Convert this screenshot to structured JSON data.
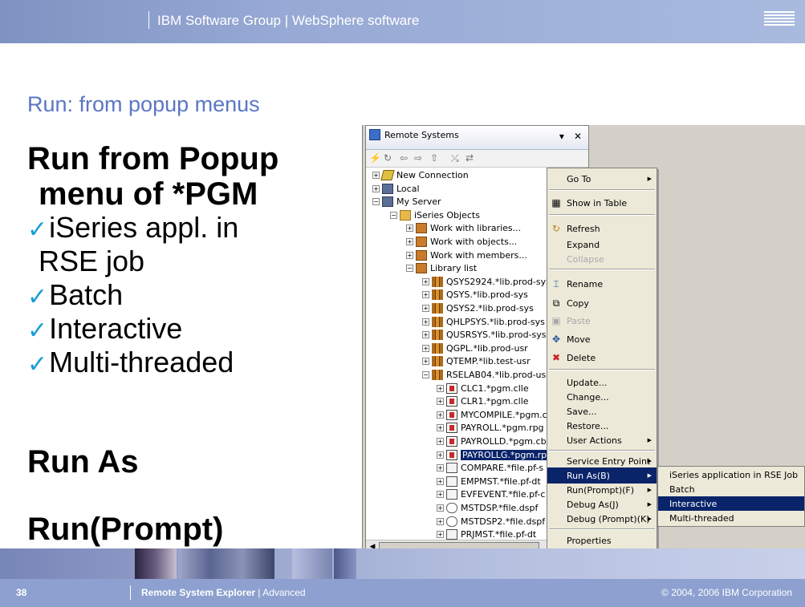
{
  "header": {
    "title": "IBM Software Group  |  WebSphere software",
    "logo_text": "IBM"
  },
  "slide": {
    "title": "Run: from popup menus",
    "heading1_line1": "Run from Popup",
    "heading1_line2": "menu of *PGM",
    "bullets": [
      {
        "check": "✓",
        "text": "iSeries appl. in"
      },
      {
        "check": "",
        "text": "RSE job"
      },
      {
        "check": "✓",
        "text": "Batch"
      },
      {
        "check": "✓",
        "text": "Interactive"
      },
      {
        "check": "✓",
        "text": "Multi-threaded"
      }
    ],
    "heading2": "Run As",
    "heading3": "Run(Prompt)",
    "check_color": "#1a9ed4"
  },
  "remote_systems": {
    "tab_title": "Remote Systems",
    "tree": [
      {
        "label": "New Connection",
        "icon": "conn"
      },
      {
        "label": "Local",
        "icon": "srv"
      },
      {
        "label": "My Server",
        "icon": "srv"
      },
      {
        "label": "iSeries Objects",
        "icon": "fold"
      },
      {
        "label": "Work with libraries...",
        "icon": "work"
      },
      {
        "label": "Work with objects...",
        "icon": "work"
      },
      {
        "label": "Work with members...",
        "icon": "work"
      },
      {
        "label": "Library list",
        "icon": "work"
      },
      {
        "label": "QSYS2924.*lib.prod-sys",
        "icon": "lib"
      },
      {
        "label": "QSYS.*lib.prod-sys",
        "icon": "lib"
      },
      {
        "label": "QSYS2.*lib.prod-sys",
        "icon": "lib"
      },
      {
        "label": "QHLPSYS.*lib.prod-sys",
        "icon": "lib"
      },
      {
        "label": "QUSRSYS.*lib.prod-sys",
        "icon": "lib"
      },
      {
        "label": "QGPL.*lib.prod-usr",
        "icon": "lib"
      },
      {
        "label": "QTEMP.*lib.test-usr",
        "icon": "lib"
      },
      {
        "label": "RSELAB04.*lib.prod-usr",
        "icon": "lib"
      },
      {
        "label": "CLC1.*pgm.clle",
        "icon": "pgm"
      },
      {
        "label": "CLR1.*pgm.clle",
        "icon": "pgm"
      },
      {
        "label": "MYCOMPILE.*pgm.c",
        "icon": "pgm"
      },
      {
        "label": "PAYROLL.*pgm.rpg",
        "icon": "pgm"
      },
      {
        "label": "PAYROLLD.*pgm.cb",
        "icon": "pgm"
      },
      {
        "label": "PAYROLLG.*pgm.rp",
        "icon": "pgm"
      },
      {
        "label": "COMPARE.*file.pf-s",
        "icon": "file"
      },
      {
        "label": "EMPMST.*file.pf-dt",
        "icon": "file"
      },
      {
        "label": "EVFEVENT.*file.pf-c",
        "icon": "file"
      },
      {
        "label": "MSTDSP.*file.dspf",
        "icon": "dspf"
      },
      {
        "label": "MSTDSP2.*file.dspf",
        "icon": "dspf"
      },
      {
        "label": "PRJMST.*file.pf-dt",
        "icon": "file"
      }
    ]
  },
  "context_menu": {
    "items": [
      "Go To",
      "Show in Table",
      "Refresh",
      "Expand",
      "Collapse",
      "Rename",
      "Copy",
      "Paste",
      "Move",
      "Delete",
      "Update...",
      "Change...",
      "Save...",
      "Restore...",
      "User Actions",
      "Service Entry Point",
      "Run As(B)",
      "Run(Prompt)(F)",
      "Debug As(J)",
      "Debug (Prompt)(K)",
      "Properties"
    ]
  },
  "run_as_submenu": {
    "items": [
      "iSeries application in RSE Job",
      "Batch",
      "Interactive",
      "Multi-threaded"
    ]
  },
  "footer": {
    "page": "38",
    "section": "Remote System Explorer",
    "subsection": "  |  Advanced",
    "copyright": "© 2004, 2006 IBM Corporation"
  },
  "colors": {
    "title_blue": "#5b76c4",
    "header_band": "#8da0cf",
    "menu_highlight": "#0a246a"
  }
}
